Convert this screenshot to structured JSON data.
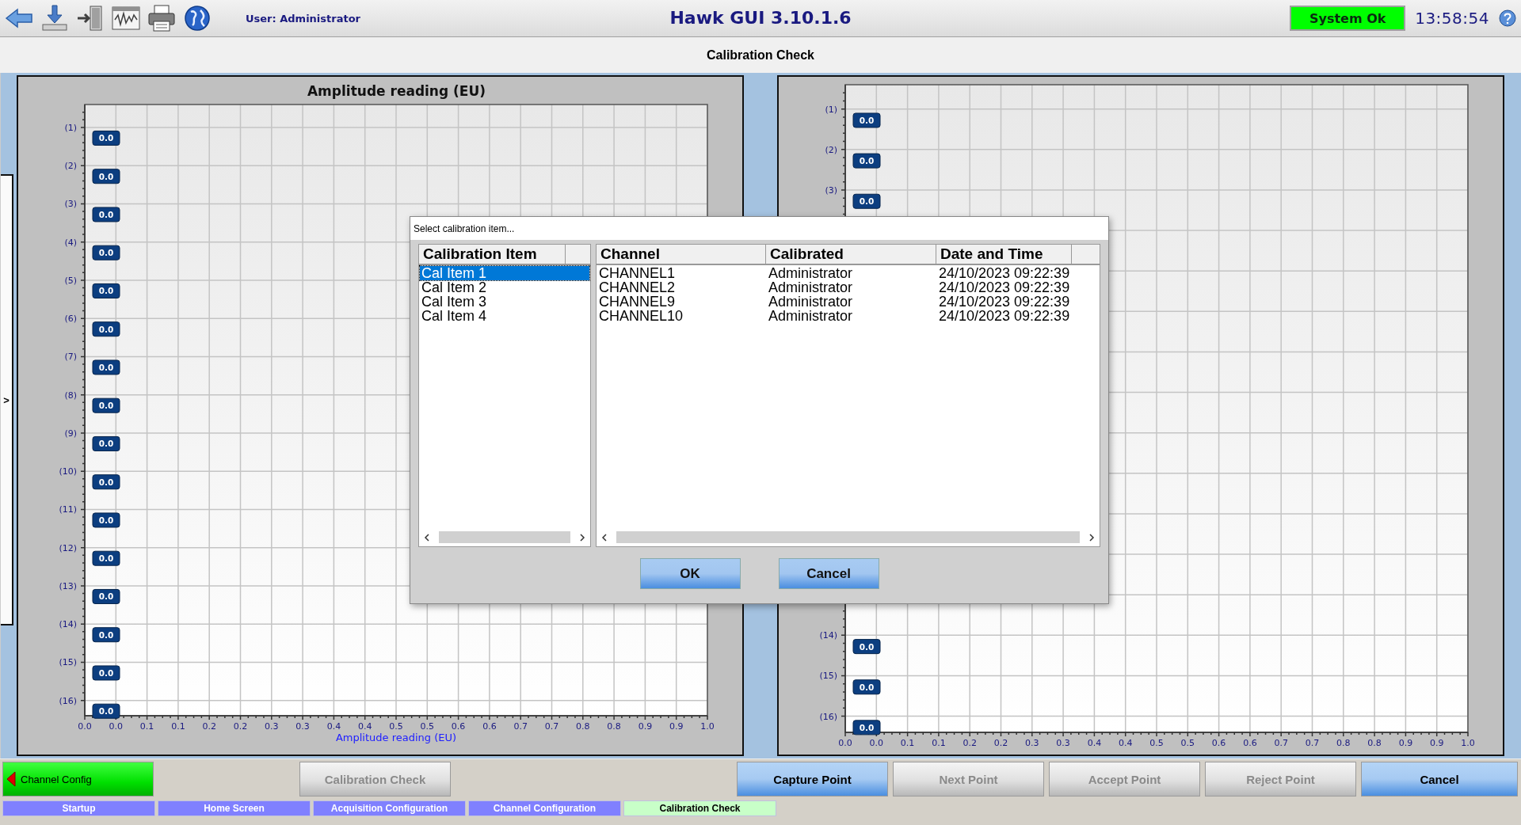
{
  "header": {
    "user": "User: Administrator",
    "title": "Hawk GUI 3.10.1.6",
    "status": "System Ok",
    "time": "13:58:54"
  },
  "page_title": "Calibration Check",
  "side_tab": ">",
  "charts": [
    {
      "chart_data": {
        "type": "bar",
        "orientation": "horizontal",
        "grid": true,
        "title": "Amplitude reading (EU)",
        "xlabel": "Amplitude reading (EU)",
        "categories": [
          "(1)",
          "(2)",
          "(3)",
          "(4)",
          "(5)",
          "(6)",
          "(7)",
          "(8)",
          "(9)",
          "(10)",
          "(11)",
          "(12)",
          "(13)",
          "(14)",
          "(15)",
          "(16)"
        ],
        "values": [
          0,
          0,
          0,
          0,
          0,
          0,
          0,
          0,
          0,
          0,
          0,
          0,
          0,
          0,
          0,
          0
        ],
        "value_labels": [
          "0.0",
          "0.0",
          "0.0",
          "0.0",
          "0.0",
          "0.0",
          "0.0",
          "0.0",
          "0.0",
          "0.0",
          "0.0",
          "0.0",
          "0.0",
          "0.0",
          "0.0",
          "0.0"
        ],
        "xlim": [
          0,
          1
        ],
        "xticks": [
          {
            "value": 0,
            "label": "0.0"
          },
          {
            "value": 0.05,
            "label": "0.0"
          },
          {
            "value": 0.1,
            "label": "0.1"
          },
          {
            "value": 0.15,
            "label": "0.1"
          },
          {
            "value": 0.2,
            "label": "0.2"
          },
          {
            "value": 0.25,
            "label": "0.2"
          },
          {
            "value": 0.3,
            "label": "0.3"
          },
          {
            "value": 0.35,
            "label": "0.3"
          },
          {
            "value": 0.4,
            "label": "0.4"
          },
          {
            "value": 0.45,
            "label": "0.4"
          },
          {
            "value": 0.5,
            "label": "0.5"
          },
          {
            "value": 0.55,
            "label": "0.5"
          },
          {
            "value": 0.6,
            "label": "0.6"
          },
          {
            "value": 0.65,
            "label": "0.6"
          },
          {
            "value": 0.7,
            "label": "0.7"
          },
          {
            "value": 0.75,
            "label": "0.7"
          },
          {
            "value": 0.8,
            "label": "0.8"
          },
          {
            "value": 0.85,
            "label": "0.8"
          },
          {
            "value": 0.9,
            "label": "0.9"
          },
          {
            "value": 0.95,
            "label": "0.9"
          },
          {
            "value": 1,
            "label": "1.0"
          }
        ]
      }
    },
    {
      "chart_data": {
        "type": "bar",
        "orientation": "horizontal",
        "grid": true,
        "categories": [
          "(1)",
          "(2)",
          "(3)",
          null,
          null,
          null,
          null,
          null,
          null,
          null,
          null,
          null,
          null,
          "(14)",
          "(15)",
          "(16)"
        ],
        "values": [
          0,
          0,
          0,
          null,
          null,
          null,
          null,
          null,
          null,
          null,
          null,
          null,
          null,
          0,
          0,
          0
        ],
        "value_labels": [
          "0.0",
          "0.0",
          "0.0",
          null,
          null,
          null,
          null,
          null,
          null,
          null,
          null,
          null,
          null,
          "0.0",
          "0.0",
          "0.0"
        ],
        "xlim": [
          0,
          1
        ],
        "xticks": [
          {
            "value": 0,
            "label": "0.0"
          },
          {
            "value": 0.05,
            "label": "0.0"
          },
          {
            "value": 0.1,
            "label": "0.1"
          },
          {
            "value": 0.15,
            "label": "0.1"
          },
          {
            "value": 0.2,
            "label": "0.2"
          },
          {
            "value": 0.25,
            "label": "0.2"
          },
          {
            "value": 0.3,
            "label": "0.3"
          },
          {
            "value": 0.35,
            "label": "0.3"
          },
          {
            "value": 0.4,
            "label": "0.4"
          },
          {
            "value": 0.45,
            "label": "0.4"
          },
          {
            "value": 0.5,
            "label": "0.5"
          },
          {
            "value": 0.55,
            "label": "0.5"
          },
          {
            "value": 0.6,
            "label": "0.6"
          },
          {
            "value": 0.65,
            "label": "0.6"
          },
          {
            "value": 0.7,
            "label": "0.7"
          },
          {
            "value": 0.75,
            "label": "0.7"
          },
          {
            "value": 0.8,
            "label": "0.8"
          },
          {
            "value": 0.85,
            "label": "0.8"
          },
          {
            "value": 0.9,
            "label": "0.9"
          },
          {
            "value": 0.95,
            "label": "0.9"
          },
          {
            "value": 1,
            "label": "1.0"
          }
        ]
      }
    }
  ],
  "dialog": {
    "title": "Select calibration item...",
    "list_header": "Calibration Item",
    "items": [
      {
        "label": "Cal Item 1",
        "selected": true
      },
      {
        "label": "Cal Item 2",
        "selected": false
      },
      {
        "label": "Cal Item 3",
        "selected": false
      },
      {
        "label": "Cal Item 4",
        "selected": false
      }
    ],
    "table": {
      "columns": [
        "Channel",
        "Calibrated",
        "Date and Time"
      ],
      "rows": [
        [
          "CHANNEL1",
          "Administrator",
          "24/10/2023 09:22:39"
        ],
        [
          "CHANNEL2",
          "Administrator",
          "24/10/2023 09:22:39"
        ],
        [
          "CHANNEL9",
          "Administrator",
          "24/10/2023 09:22:39"
        ],
        [
          "CHANNEL10",
          "Administrator",
          "24/10/2023 09:22:39"
        ]
      ]
    },
    "buttons": [
      "OK",
      "Cancel"
    ]
  },
  "action_buttons": [
    {
      "label": "Channel Config",
      "kind": "back",
      "disabled": false
    },
    {
      "label": "Calibration Check",
      "kind": "action",
      "disabled": true
    },
    {
      "label": "Capture Point",
      "kind": "action",
      "disabled": false
    },
    {
      "label": "Next Point",
      "kind": "action",
      "disabled": true
    },
    {
      "label": "Accept Point",
      "kind": "action",
      "disabled": true
    },
    {
      "label": "Reject Point",
      "kind": "action",
      "disabled": true
    },
    {
      "label": "Cancel",
      "kind": "action",
      "disabled": false
    }
  ],
  "nav_tabs": [
    {
      "label": "Startup",
      "selected": false
    },
    {
      "label": "Home Screen",
      "selected": false
    },
    {
      "label": "Acquisition Configuration",
      "selected": false
    },
    {
      "label": "Channel Configuration",
      "selected": false
    },
    {
      "label": "Calibration Check",
      "selected": true
    }
  ]
}
